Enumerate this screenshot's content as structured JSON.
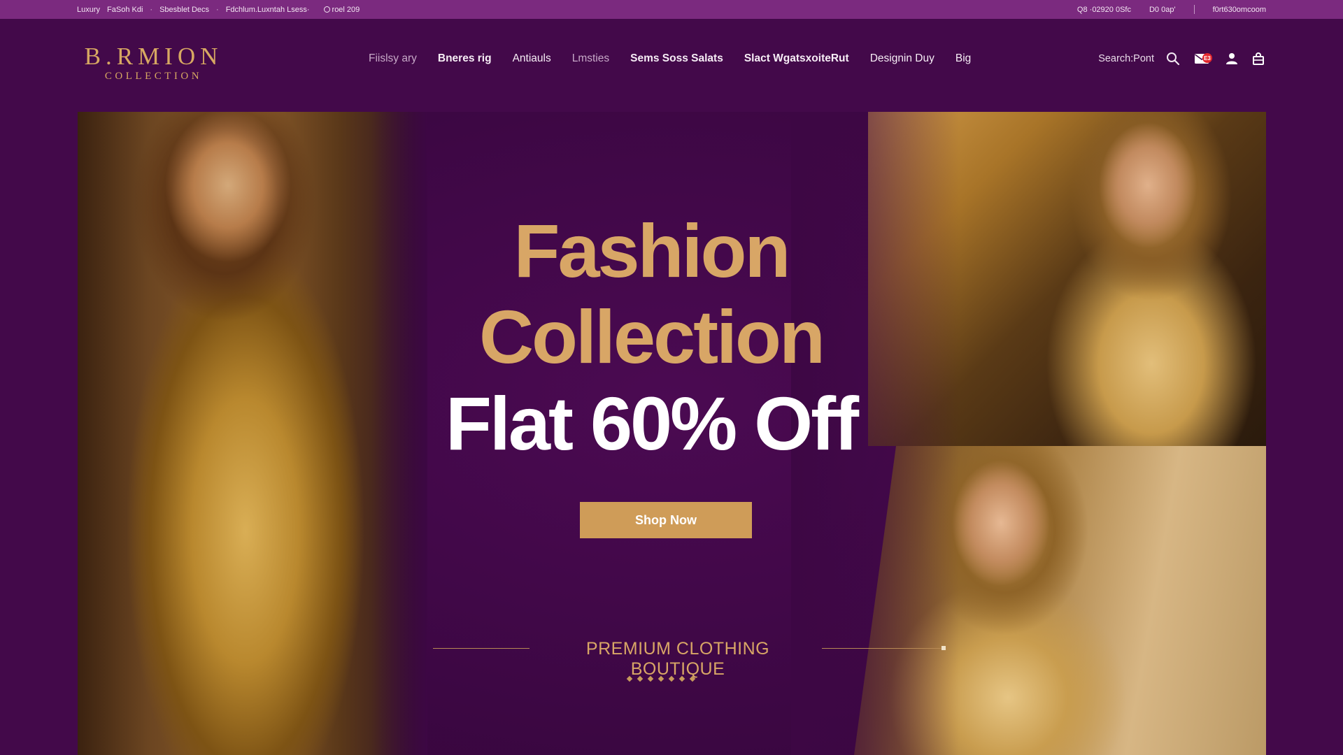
{
  "topbar": {
    "left_text_1": "Luxury",
    "left_text_2": "FaSoh Kdi",
    "left_text_3": "Sbesblet Decs",
    "left_text_4": "Fdchlum.Luxntah Lsess·",
    "left_text_5": "roel 209",
    "right_text_1": "Q8 ·02920 0Sfc",
    "right_text_2": "D0 0ap'",
    "right_text_3": "f0rt630omcoom"
  },
  "header": {
    "logo_brand": "B.RMION",
    "logo_sub": "COLLECTION",
    "nav": [
      {
        "label": "Fiislsy ary"
      },
      {
        "label": "Bneres rig"
      },
      {
        "label": "Antiauls"
      },
      {
        "label": "Lmsties"
      },
      {
        "label": "Sems Soss Salats"
      },
      {
        "label": "Slact WgatsxoiteRut"
      },
      {
        "label": "Designin Duy"
      },
      {
        "label": "Big"
      }
    ],
    "search_label": "Search:Pont",
    "mail_badge": "E3",
    "icons": [
      "search-icon",
      "mail-icon",
      "user-icon",
      "shopping-bag-icon"
    ]
  },
  "hero": {
    "headline_1": "Fashion",
    "headline_2": "Collection",
    "headline_3": "Flat 60% Off",
    "cta_label": "Shop Now",
    "tagline": "PREMIUM CLOTHING BOUTIQUE"
  },
  "colors": {
    "background": "#43094a",
    "topbar": "#7b2a7f",
    "gold": "#d8a666",
    "button": "#cf9c58"
  }
}
